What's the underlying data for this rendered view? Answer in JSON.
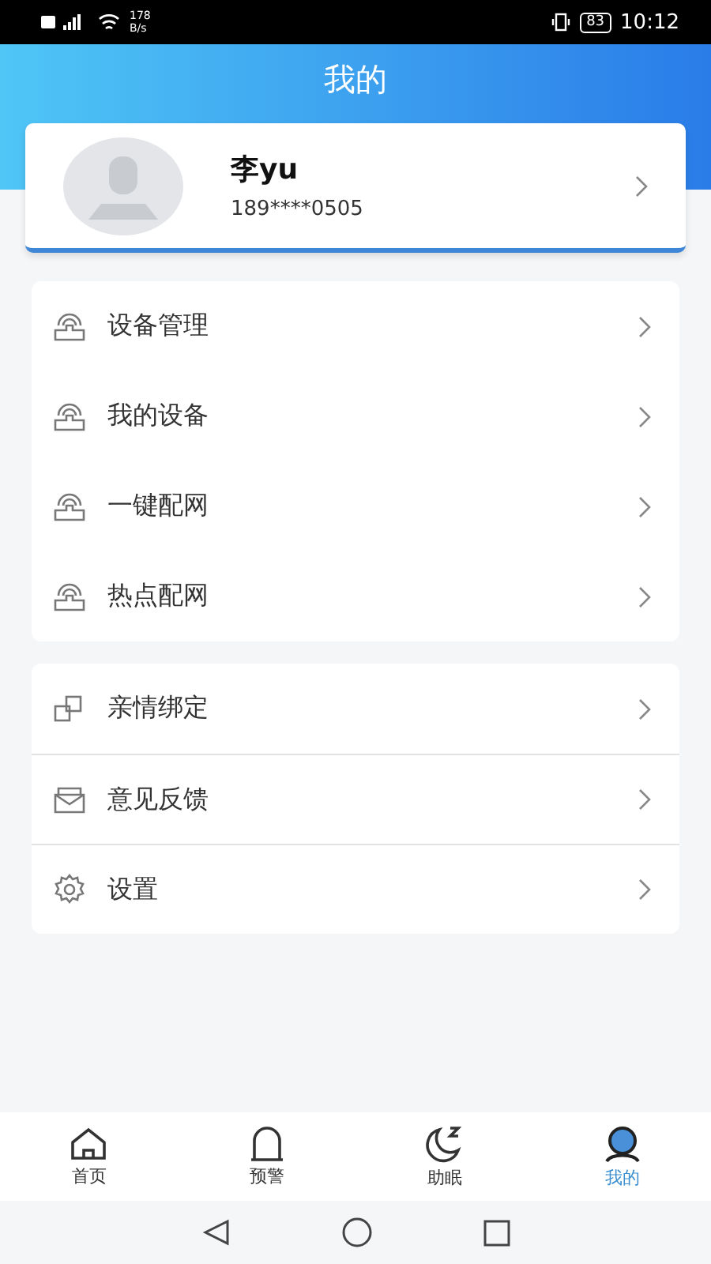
{
  "status_bar": {
    "speed_value": "178",
    "speed_unit": "B/s",
    "battery": "83",
    "time": "10:12"
  },
  "header": {
    "title": "我的"
  },
  "profile": {
    "name": "李yu",
    "phone": "189****0505"
  },
  "menu_groups": [
    {
      "items": [
        {
          "kind": "router",
          "label": "设备管理"
        },
        {
          "kind": "router",
          "label": "我的设备"
        },
        {
          "kind": "router",
          "label": "一键配网"
        },
        {
          "kind": "router",
          "label": "热点配网"
        }
      ],
      "dividers": false
    },
    {
      "items": [
        {
          "kind": "link",
          "label": "亲情绑定"
        },
        {
          "kind": "mail",
          "label": "意见反馈"
        },
        {
          "kind": "gear",
          "label": "设置"
        }
      ],
      "dividers": true
    }
  ],
  "tab_bar": [
    {
      "kind": "home",
      "label": "首页",
      "selected": false
    },
    {
      "kind": "alert",
      "label": "预警",
      "selected": false
    },
    {
      "kind": "sleep",
      "label": "助眠",
      "selected": false
    },
    {
      "kind": "profile",
      "label": "我的",
      "selected": true
    }
  ]
}
